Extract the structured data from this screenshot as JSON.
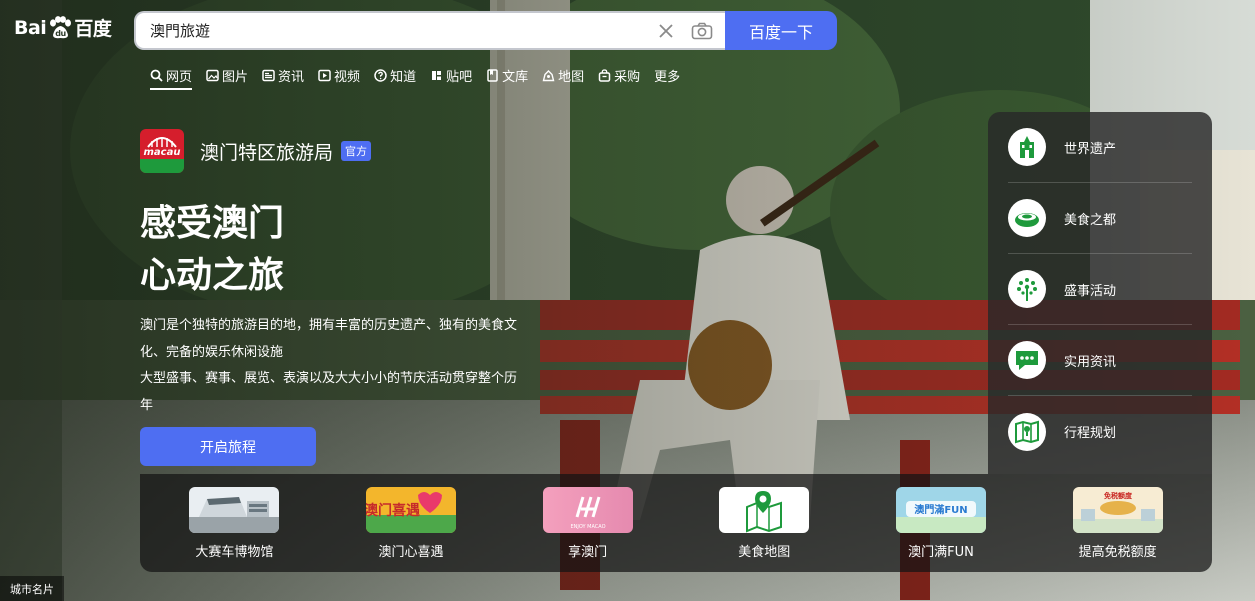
{
  "logo": {
    "text_left": "Bai",
    "text_right": "百度"
  },
  "search": {
    "value": "澳門旅遊",
    "button_label": "百度一下"
  },
  "nav": {
    "items": [
      {
        "label": "网页",
        "icon": "search-icon",
        "active": true
      },
      {
        "label": "图片",
        "icon": "image-icon"
      },
      {
        "label": "资讯",
        "icon": "news-icon"
      },
      {
        "label": "视频",
        "icon": "video-icon"
      },
      {
        "label": "知道",
        "icon": "question-icon"
      },
      {
        "label": "贴吧",
        "icon": "tieba-icon"
      },
      {
        "label": "文库",
        "icon": "doc-icon"
      },
      {
        "label": "地图",
        "icon": "map-icon"
      },
      {
        "label": "采购",
        "icon": "bag-icon"
      },
      {
        "label": "更多",
        "icon": ""
      }
    ]
  },
  "brand": {
    "logo_text": "macau",
    "name": "澳门特区旅游局",
    "badge": "官方"
  },
  "hero": {
    "line1": "感受澳门",
    "line2": "心动之旅",
    "desc1": "澳门是个独特的旅游目的地，拥有丰富的历史遗产、独有的美食文化、完备的娱乐休闲设施",
    "desc2": "大型盛事、赛事、展览、表演以及大大小小的节庆活动贯穿整个历年",
    "cta": "开启旅程"
  },
  "side_panel": {
    "items": [
      {
        "label": "世界遗产",
        "icon": "heritage-icon"
      },
      {
        "label": "美食之都",
        "icon": "food-icon"
      },
      {
        "label": "盛事活动",
        "icon": "event-icon"
      },
      {
        "label": "实用资讯",
        "icon": "chat-icon"
      },
      {
        "label": "行程规划",
        "icon": "map-plan-icon"
      }
    ]
  },
  "tiles": [
    {
      "label": "大赛车博物馆"
    },
    {
      "label": "澳门心喜遇",
      "img_text": "澳门喜遇"
    },
    {
      "label": "享澳门",
      "img_text": "ENJOY MACAO"
    },
    {
      "label": "美食地图"
    },
    {
      "label": "澳门满FUN",
      "img_text": "澳門滿FUN"
    },
    {
      "label": "提高免税额度",
      "img_text": "免税额度"
    }
  ],
  "city_card": "城市名片",
  "colors": {
    "accent": "#4e6ef2",
    "green_icon": "#1e9a3c"
  }
}
